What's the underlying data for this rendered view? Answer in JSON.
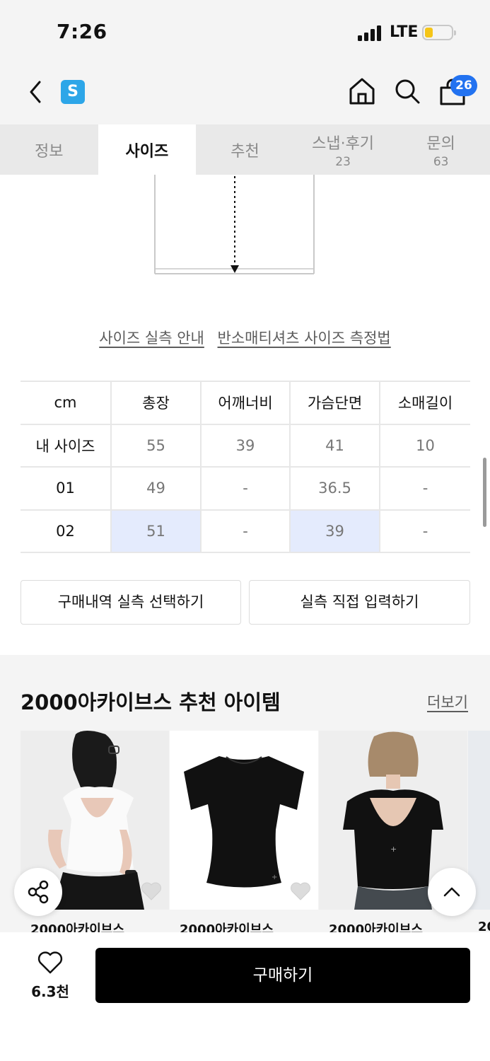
{
  "status": {
    "time": "7:26",
    "network": "LTE"
  },
  "header": {
    "logo_letter": "S",
    "cart_count": "26"
  },
  "tabs": [
    {
      "label": "정보",
      "count": ""
    },
    {
      "label": "사이즈",
      "count": ""
    },
    {
      "label": "추천",
      "count": ""
    },
    {
      "label": "스냅·후기",
      "count": "23"
    },
    {
      "label": "문의",
      "count": "63"
    }
  ],
  "size_links": {
    "guide": "사이즈 실측 안내",
    "howto": "반소매티셔츠 사이즈 측정법"
  },
  "size_table": {
    "headers": [
      "cm",
      "총장",
      "어깨너비",
      "가슴단면",
      "소매길이"
    ],
    "rows": [
      [
        "내 사이즈",
        "55",
        "39",
        "41",
        "10"
      ],
      [
        "01",
        "49",
        "-",
        "36.5",
        "-"
      ],
      [
        "02",
        "51",
        "-",
        "39",
        "-"
      ]
    ]
  },
  "actions": {
    "select_purchase": "구매내역 실측 선택하기",
    "manual_input": "실측 직접 입력하기"
  },
  "recommend": {
    "title": "2000아카이브스 추천 아이템",
    "more": "더보기",
    "products": [
      {
        "brand": "2000아카이브스"
      },
      {
        "brand": "2000아카이브스"
      },
      {
        "brand": "2000아카이브스"
      },
      {
        "brand": "20"
      }
    ]
  },
  "bottom": {
    "like_count": "6.3천",
    "buy_label": "구매하기"
  },
  "colors": {
    "accent_badge": "#2272f0",
    "logo": "#2da6e8",
    "highlight_cell": "#e4ebfd"
  }
}
